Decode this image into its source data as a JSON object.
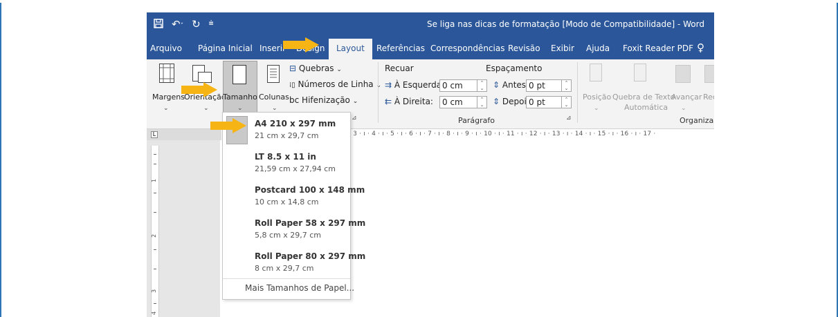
{
  "window": {
    "title": "Se liga nas dicas de formatação [Modo de Compatibilidade]  -  Word"
  },
  "quick_access": {
    "save_icon": "save-icon",
    "undo_icon": "undo-icon",
    "redo_icon": "redo-icon",
    "customize_icon": "customize-qat-icon"
  },
  "tabs": [
    {
      "label": "Arquivo"
    },
    {
      "label": "Página Inicial"
    },
    {
      "label": "Inserir"
    },
    {
      "label": "Design"
    },
    {
      "label": "Layout",
      "active": true
    },
    {
      "label": "Referências"
    },
    {
      "label": "Correspondências"
    },
    {
      "label": "Revisão"
    },
    {
      "label": "Exibir"
    },
    {
      "label": "Ajuda"
    },
    {
      "label": "Foxit Reader PDF"
    }
  ],
  "ribbon": {
    "margens": "Margens",
    "orientacao": "Orientação",
    "tamanho": "Tamanho",
    "colunas": "Colunas",
    "quebras": "Quebras",
    "numeros_linha": "Números de Linha",
    "hifenizacao": "Hifenização",
    "recuar": "Recuar",
    "esquerda_label": "À Esquerda:",
    "esquerda_value": "0 cm",
    "direita_label": "À Direita:",
    "direita_value": "0 cm",
    "espacamento": "Espaçamento",
    "antes_label": "Antes:",
    "antes_value": "0 pt",
    "depois_label": "Depois:",
    "depois_value": "0 pt",
    "paragrafo_group": "Parágrafo",
    "posicao": "Posição",
    "quebra_texto_1": "Quebra de Texto",
    "quebra_texto_2": "Automática",
    "avancar": "Avançar",
    "recuar_obj": "Rec",
    "organizar_group": "Organizar"
  },
  "ruler": {
    "numbers": "· 3 · ı · 4 · ı · 5 · ı · 6 · ı · 7 · ı · 8 · ı · 9 · ı · 10 · ı · 11 · ı · 12 · ı · 13 · ı · 14 · ı · 15 · ı · 16 · ı · 17 ·",
    "corner": "L",
    "v1": "1",
    "v2": "2",
    "v3": "3",
    "v4": "4"
  },
  "size_menu": {
    "items": [
      {
        "name": "A4 210 x 297 mm",
        "dims": "21 cm x 29,7 cm",
        "selected": true
      },
      {
        "name": "LT 8.5 x 11 in",
        "dims": "21,59 cm x 27,94 cm"
      },
      {
        "name": "Postcard 100 x 148 mm",
        "dims": "10 cm x 14,8 cm"
      },
      {
        "name": "Roll Paper 58 x 297 mm",
        "dims": "5,8 cm x 29,7 cm"
      },
      {
        "name": "Roll Paper 80 x 297 mm",
        "dims": "8 cm x 29,7 cm"
      }
    ],
    "more": "Mais Tamanhos de Papel..."
  },
  "colors": {
    "title_bar": "#2b579a",
    "ribbon_bg": "#f3f3f3",
    "arrow": "#f6b514",
    "frame": "#2e75b6"
  }
}
